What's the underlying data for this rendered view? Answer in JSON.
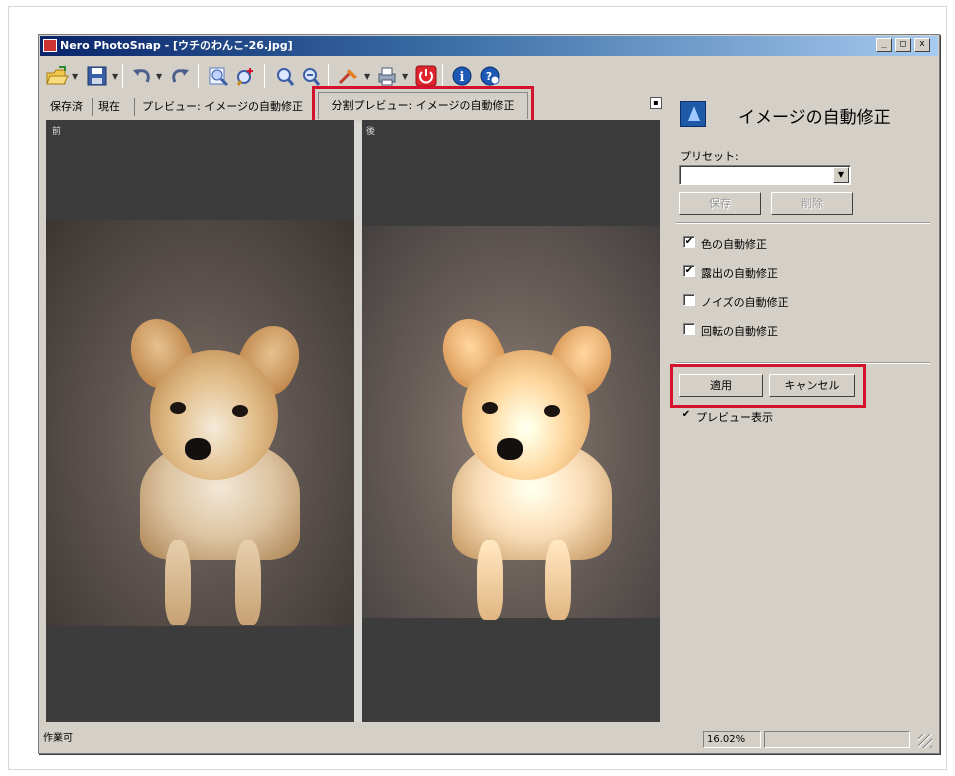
{
  "window": {
    "title": "Nero PhotoSnap - [ウチのわんこ-26.jpg]",
    "min_label": "_",
    "max_label": "□",
    "close_label": "x"
  },
  "tabs": [
    {
      "label": "保存済"
    },
    {
      "label": "現在"
    },
    {
      "label": "プレビュー: イメージの自動修正"
    },
    {
      "label": "分割プレビュー: イメージの自動修正",
      "active": true
    }
  ],
  "preview": {
    "left_label": "前",
    "right_label": "後"
  },
  "panel": {
    "title": "イメージの自動修正",
    "preset_label": "プリセット:",
    "preset_value": "",
    "save_button": "保存",
    "delete_button": "削除",
    "options": [
      {
        "label": "色の自動修正",
        "checked": true
      },
      {
        "label": "露出の自動修正",
        "checked": true
      },
      {
        "label": "ノイズの自動修正",
        "checked": false
      },
      {
        "label": "回転の自動修正",
        "checked": false
      }
    ],
    "apply_button": "適用",
    "cancel_button": "キャンセル",
    "preview_toggle": {
      "label": "プレビュー表示",
      "checked": true
    }
  },
  "status": {
    "text": "作業可",
    "zoom": "16.02%"
  },
  "colors": {
    "highlight": "#d3122b",
    "titlebar_start": "#0a246a",
    "titlebar_end": "#a6caf0",
    "window_bg": "#d4d0c8"
  },
  "toolbar_icons": [
    "open-icon",
    "save-icon",
    "undo-icon",
    "redo-icon",
    "zoom-fit-icon",
    "zoom-in-icon",
    "zoom-out-icon",
    "zoom-reduce-icon",
    "tools-icon",
    "print-icon",
    "power-icon",
    "info-icon",
    "help-icon"
  ]
}
